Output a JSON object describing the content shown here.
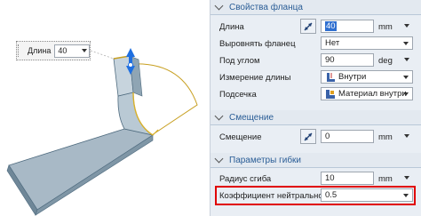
{
  "viewport": {
    "tag_label": "Длина",
    "tag_value": "40"
  },
  "panel": {
    "flange_section": {
      "title": "Свойства фланца",
      "length": {
        "label": "Длина",
        "value": "40",
        "unit": "mm"
      },
      "align": {
        "label": "Выровнять фланец",
        "value": "Нет"
      },
      "angle": {
        "label": "Под углом",
        "value": "90",
        "unit": "deg"
      },
      "length_measure": {
        "label": "Измерение длины",
        "value": "Внутри"
      },
      "relief": {
        "label": "Подсечка",
        "value": "Материал внутри"
      }
    },
    "offset_section": {
      "title": "Смещение",
      "offset": {
        "label": "Смещение",
        "value": "0",
        "unit": "mm"
      }
    },
    "bend_section": {
      "title": "Параметры гибки",
      "radius": {
        "label": "Радиус сгиба",
        "value": "10",
        "unit": "mm"
      },
      "neutral_factor": {
        "label": "Коэффициент нейтрального слоя",
        "value": "0.5"
      }
    }
  },
  "colors": {
    "section_title": "#2a5d96",
    "highlight": "#e00000",
    "selection": "#2f6fd0"
  }
}
